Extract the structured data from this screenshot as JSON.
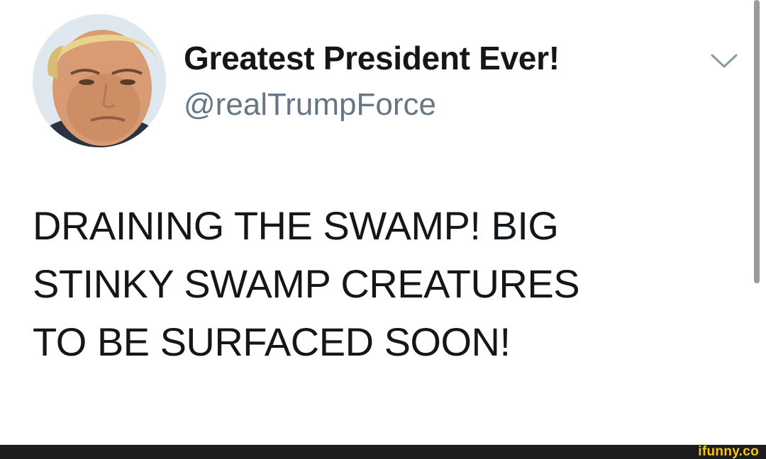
{
  "tweet": {
    "display_name": "Greatest President Ever!",
    "handle": "@realTrumpForce",
    "text_lines": [
      "DRAINING THE SWAMP!  BIG",
      "STINKY SWAMP CREATURES",
      "TO BE SURFACED SOON!"
    ]
  },
  "icons": {
    "avatar": "profile-photo",
    "caret": "chevron-down-icon"
  },
  "watermark": {
    "text": "ifunny.co"
  },
  "colors": {
    "name": "#14171a",
    "handle": "#657786",
    "watermark": "#f5c518",
    "watermark_bar": "#1c1c1c"
  }
}
